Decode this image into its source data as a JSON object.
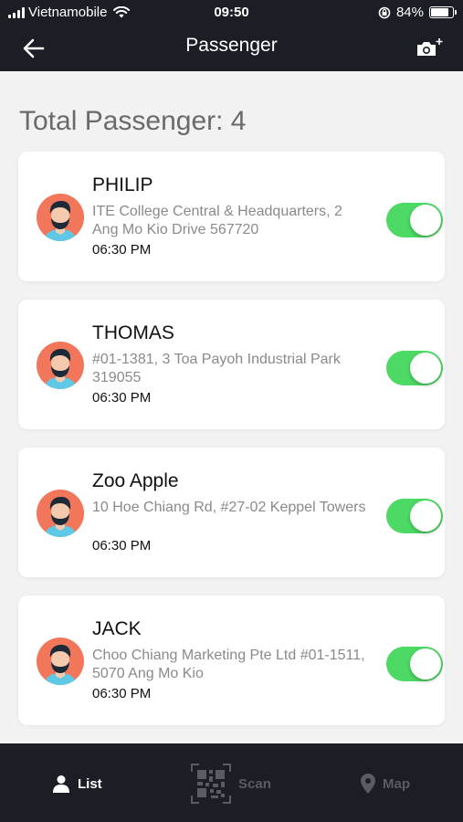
{
  "status_bar": {
    "carrier": "Vietnamobile",
    "time": "09:50",
    "battery": "84%",
    "battery_level": 0.84
  },
  "header": {
    "title": "Passenger",
    "back_icon": "arrow-left-icon",
    "camera_icon": "camera-add-icon"
  },
  "summary": {
    "total_label": "Total Passenger: 4"
  },
  "passengers": [
    {
      "name": "PHILIP",
      "address": "ITE College Central & Headquarters, 2 Ang Mo Kio Drive 567720",
      "time": "06:30 PM",
      "enabled": true
    },
    {
      "name": "THOMAS",
      "address": "#01-1381, 3 Toa Payoh Industrial Park 319055",
      "time": "06:30 PM",
      "enabled": true
    },
    {
      "name": "Zoo Apple",
      "address": "10 Hoe Chiang Rd, #27-02 Keppel Towers",
      "time": "06:30 PM",
      "enabled": true
    },
    {
      "name": "JACK",
      "address": "Choo Chiang Marketing Pte Ltd #01-1511, 5070 Ang Mo Kio",
      "time": "06:30 PM",
      "enabled": true
    }
  ],
  "tabs": {
    "list": "List",
    "scan": "Scan",
    "map": "Map",
    "active": "list"
  },
  "colors": {
    "bar_background": "#1c1e25",
    "toggle_on": "#4cd964",
    "avatar_background": "#f1765a"
  }
}
